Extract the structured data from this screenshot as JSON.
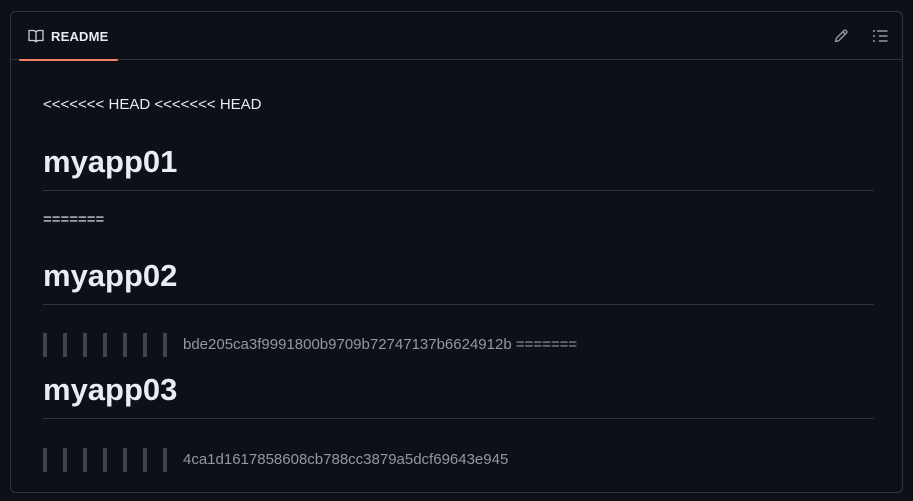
{
  "tab": {
    "label": "README",
    "icon": "book-icon",
    "active_color": "#f78166"
  },
  "toolbar": {
    "edit_icon": "pencil-icon",
    "outline_icon": "list-icon"
  },
  "readme": {
    "conflict_head": "<<<<<<< HEAD <<<<<<< HEAD",
    "heading1": "myapp01",
    "separator": "=======",
    "heading2": "myapp02",
    "quote1": "bde205ca3f9991800b9709b72747137b6624912b =======",
    "heading3": "myapp03",
    "quote2": "4ca1d1617858608cb788cc3879a5dcf69643e945"
  }
}
